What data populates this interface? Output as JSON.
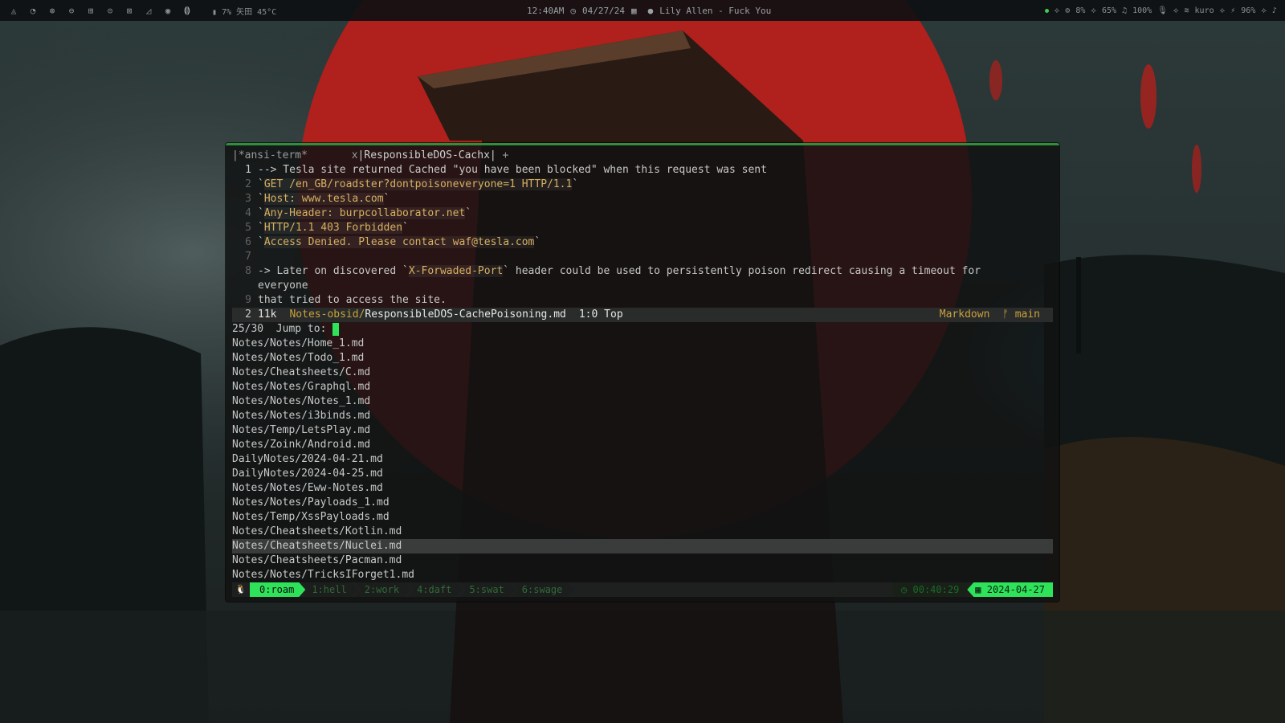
{
  "topbar": {
    "system_stats": "7% 矢田 45°C",
    "clock": "12:40AM",
    "date": "04/27/24",
    "now_playing": "Lily Allen - Fuck You",
    "cpu": "8%",
    "mem": "65%",
    "volume": "100%",
    "user": "kuro",
    "battery": "96%"
  },
  "terminal": {
    "tabs": [
      {
        "label": "|*ansi-term*       x"
      },
      {
        "label": "|ResponsibleDOS-Cachx|"
      },
      {
        "label": " +"
      }
    ],
    "lines": [
      {
        "num": "1",
        "text": "--> Tesla site returned Cached \"you have been blocked\" when this request was sent"
      },
      {
        "num": "2",
        "text_prefix": "`",
        "code": "GET /en_GB/roadster?dontpoisoneveryone=1 HTTP/1.1",
        "text_suffix": "`"
      },
      {
        "num": "3",
        "text_prefix": "`",
        "code": "Host: www.tesla.com",
        "text_suffix": "`"
      },
      {
        "num": "4",
        "text_prefix": "`",
        "code": "Any-Header: burpcollaborator.net",
        "text_suffix": "`"
      },
      {
        "num": "5",
        "text_prefix": "`",
        "code": "HTTP/1.1 403 Forbidden",
        "text_suffix": "`"
      },
      {
        "num": "6",
        "text_prefix": "`",
        "code": "Access Denied. Please contact waf@tesla.com",
        "text_suffix": "`"
      },
      {
        "num": "7",
        "text": ""
      },
      {
        "num": "8",
        "text_prefix": "-> Later on discovered `",
        "code": "X-Forwaded-Port",
        "text_suffix": "` header could be used to persistently poison redirect causing a timeout for"
      },
      {
        "num": "",
        "text": "everyone"
      },
      {
        "num": "9",
        "text": "that tried to access the site."
      }
    ],
    "statusline": {
      "num": "2",
      "size": "11k",
      "dir": "Notes-obsid/",
      "file": "ResponsibleDOS-CachePoisoning.md",
      "position": "1:0 Top",
      "mode": "Markdown",
      "branch": "ᚠ main"
    },
    "prompt": {
      "count": "25/30",
      "label": "Jump to:"
    },
    "files": [
      "Notes/Notes/Home_1.md",
      "Notes/Notes/Todo_1.md",
      "Notes/Cheatsheets/C.md",
      "Notes/Notes/Graphql.md",
      "Notes/Notes/Notes_1.md",
      "Notes/Notes/i3binds.md",
      "Notes/Temp/LetsPlay.md",
      "Notes/Zoink/Android.md",
      "DailyNotes/2024-04-21.md",
      "DailyNotes/2024-04-25.md",
      "Notes/Notes/Eww-Notes.md",
      "Notes/Notes/Payloads_1.md",
      "Notes/Temp/XssPayloads.md",
      "Notes/Cheatsheets/Kotlin.md",
      "Notes/Cheatsheets/Nuclei.md",
      "Notes/Cheatsheets/Pacman.md",
      "Notes/Notes/TricksIForget1.md"
    ],
    "selected_file": "Notes/Cheatsheets/Nuclei.md"
  },
  "tmux": {
    "windows": [
      "0:roam",
      "1:hell",
      "2:work",
      "4:daft",
      "5:swat",
      "6:swage"
    ],
    "active_window": "0:roam",
    "time": "00:40:29",
    "date": "2024-04-27"
  },
  "colors": {
    "accent_green": "#2ee25a",
    "code_yellow": "#d7b060",
    "sun_red": "#b0201c"
  }
}
